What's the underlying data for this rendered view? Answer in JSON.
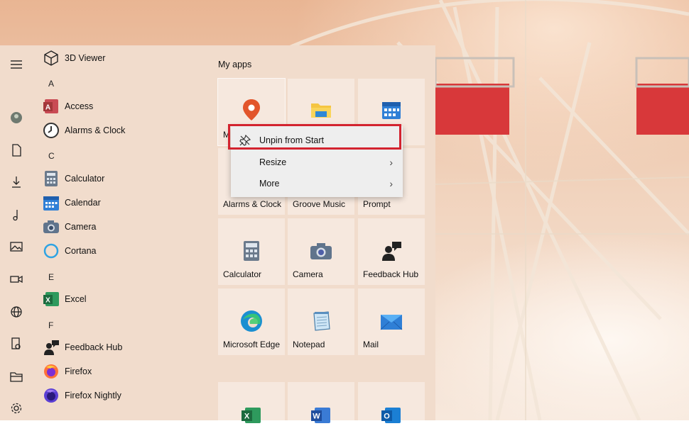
{
  "applist": {
    "top_item": "3D Viewer",
    "letters": [
      "A",
      "C",
      "E",
      "F"
    ],
    "items": [
      "Access",
      "Alarms & Clock",
      "Calculator",
      "Calendar",
      "Camera",
      "Cortana",
      "Excel",
      "Feedback Hub",
      "Firefox",
      "Firefox Nightly"
    ]
  },
  "tiles": {
    "group_title": "My apps",
    "row1_partial": "M",
    "row2": [
      "Alarms & Clock",
      "Groove Music",
      "Command Prompt"
    ],
    "row3": [
      "Calculator",
      "Camera",
      "Feedback Hub"
    ],
    "row4": [
      "Microsoft Edge",
      "Notepad",
      "Mail"
    ]
  },
  "context_menu": {
    "items": [
      "Unpin from Start",
      "Resize",
      "More"
    ]
  },
  "colors": {
    "highlight": "#d3232f",
    "menu_bg": "#eeeeee",
    "start_bg": "#f1dccc"
  }
}
